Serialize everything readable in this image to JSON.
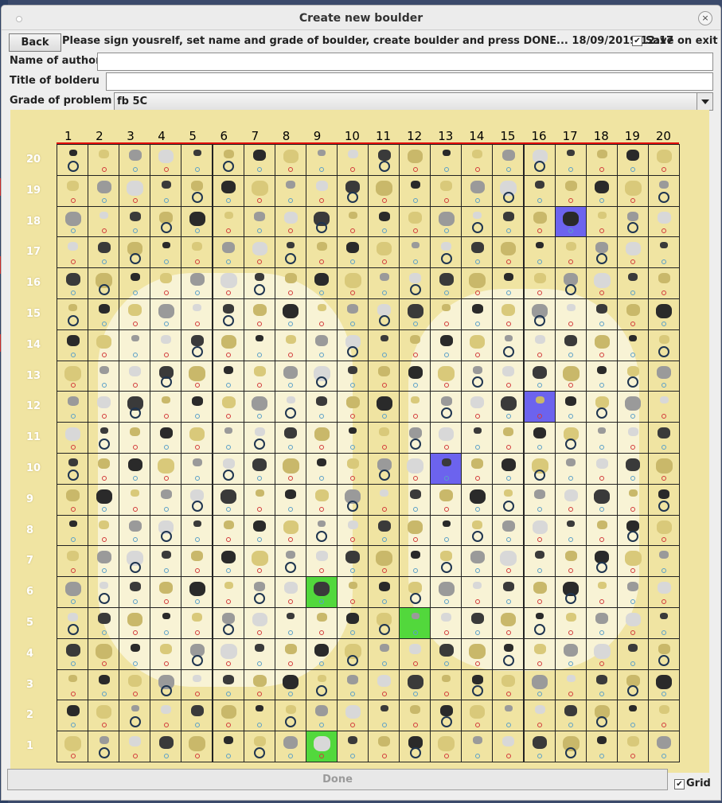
{
  "window": {
    "title": "Create new boulder"
  },
  "toolbar": {
    "back_label": "Back",
    "instruction": "Please sign yousrelf, set name and grade of boulder, create boulder and press DONE...",
    "datetime": "18/09/2019 12:17",
    "save_on_exit_label": "Save on exit",
    "save_on_exit_checked": true
  },
  "form": {
    "author_label": "Name of author",
    "author_value": "",
    "title_label": "Title of bolderu",
    "title_value": "",
    "grade_label": "Grade of problem",
    "grade_value": "fb 5C"
  },
  "board": {
    "columns": [
      "1",
      "2",
      "3",
      "4",
      "5",
      "6",
      "7",
      "8",
      "9",
      "10",
      "11",
      "12",
      "13",
      "14",
      "15",
      "16",
      "17",
      "18",
      "19",
      "20"
    ],
    "rows": [
      "20",
      "19",
      "18",
      "17",
      "16",
      "15",
      "14",
      "13",
      "12",
      "11",
      "10",
      "9",
      "8",
      "7",
      "6",
      "5",
      "4",
      "3",
      "2",
      "1"
    ],
    "selected_blue": [
      {
        "col": 17,
        "row": 18
      },
      {
        "col": 16,
        "row": 12
      },
      {
        "col": 13,
        "row": 10
      }
    ],
    "selected_green": [
      {
        "col": 9,
        "row": 6
      },
      {
        "col": 12,
        "row": 5
      },
      {
        "col": 9,
        "row": 1
      }
    ],
    "colors": {
      "wall": "#f0e4a2",
      "blue": "#6c63ee",
      "green": "#52d83c",
      "bar": "#e00000"
    }
  },
  "footer": {
    "done_label": "Done",
    "grid_label": "Grid",
    "grid_checked": true
  }
}
